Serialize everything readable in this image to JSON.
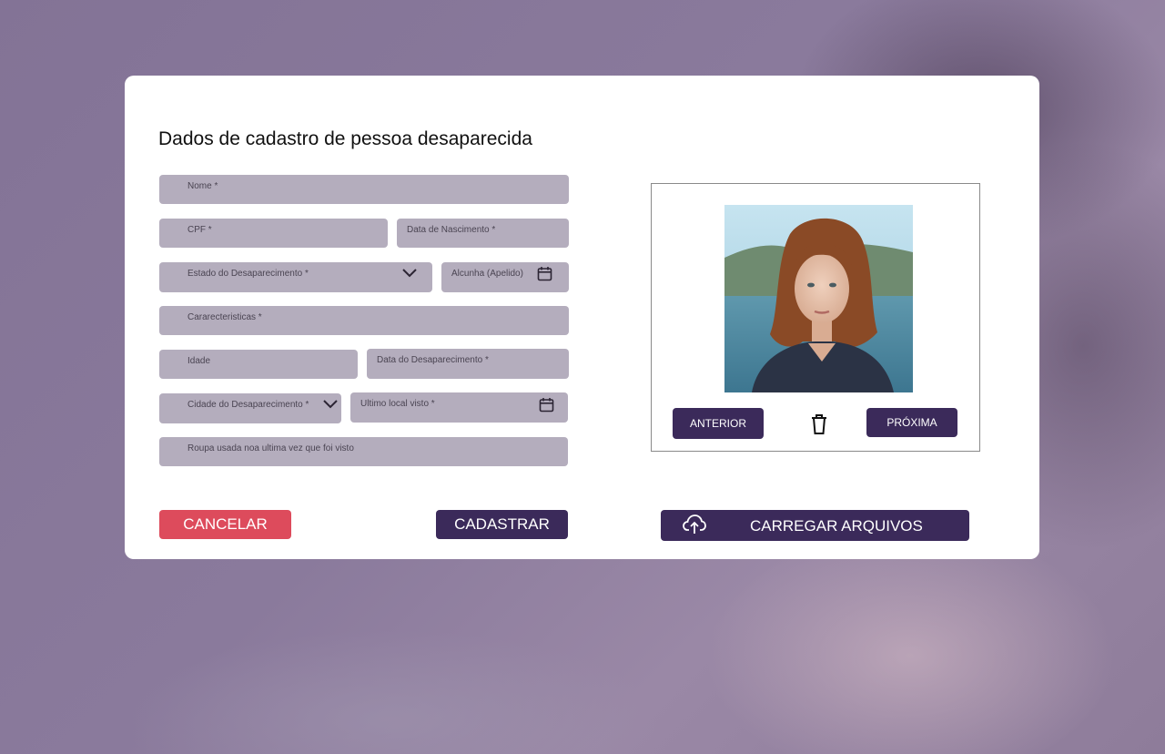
{
  "form": {
    "title": "Dados de cadastro de pessoa desaparecida",
    "fields": {
      "nome": "Nome *",
      "cpf": "CPF *",
      "data_nascimento": "Data de Nascimento *",
      "estado_desaparecimento": "Estado do Desaparecimento *",
      "alcunha": "Alcunha (Apelido)",
      "caracteristicas": "Cararecteristicas *",
      "idade": "Idade",
      "data_desaparecimento": "Data do Desaparecimento *",
      "cidade_desaparecimento": "Cidade do Desaparecimento *",
      "ultimo_local": "Ultimo local visto *",
      "roupa": "Roupa usada noa ultima vez que foi visto"
    },
    "actions": {
      "cancel_label": "CANCELAR",
      "submit_label": "CADASTRAR"
    }
  },
  "gallery": {
    "prev_label": "ANTERIOR",
    "next_label": "PRÓXIMA",
    "delete_icon": "trash-icon",
    "upload_label": "CARREGAR ARQUIVOS",
    "upload_icon": "cloud-upload-icon"
  },
  "colors": {
    "primary": "#3b2a5a",
    "danger": "#dd4b5c",
    "field_bg": "#b4adbd"
  }
}
